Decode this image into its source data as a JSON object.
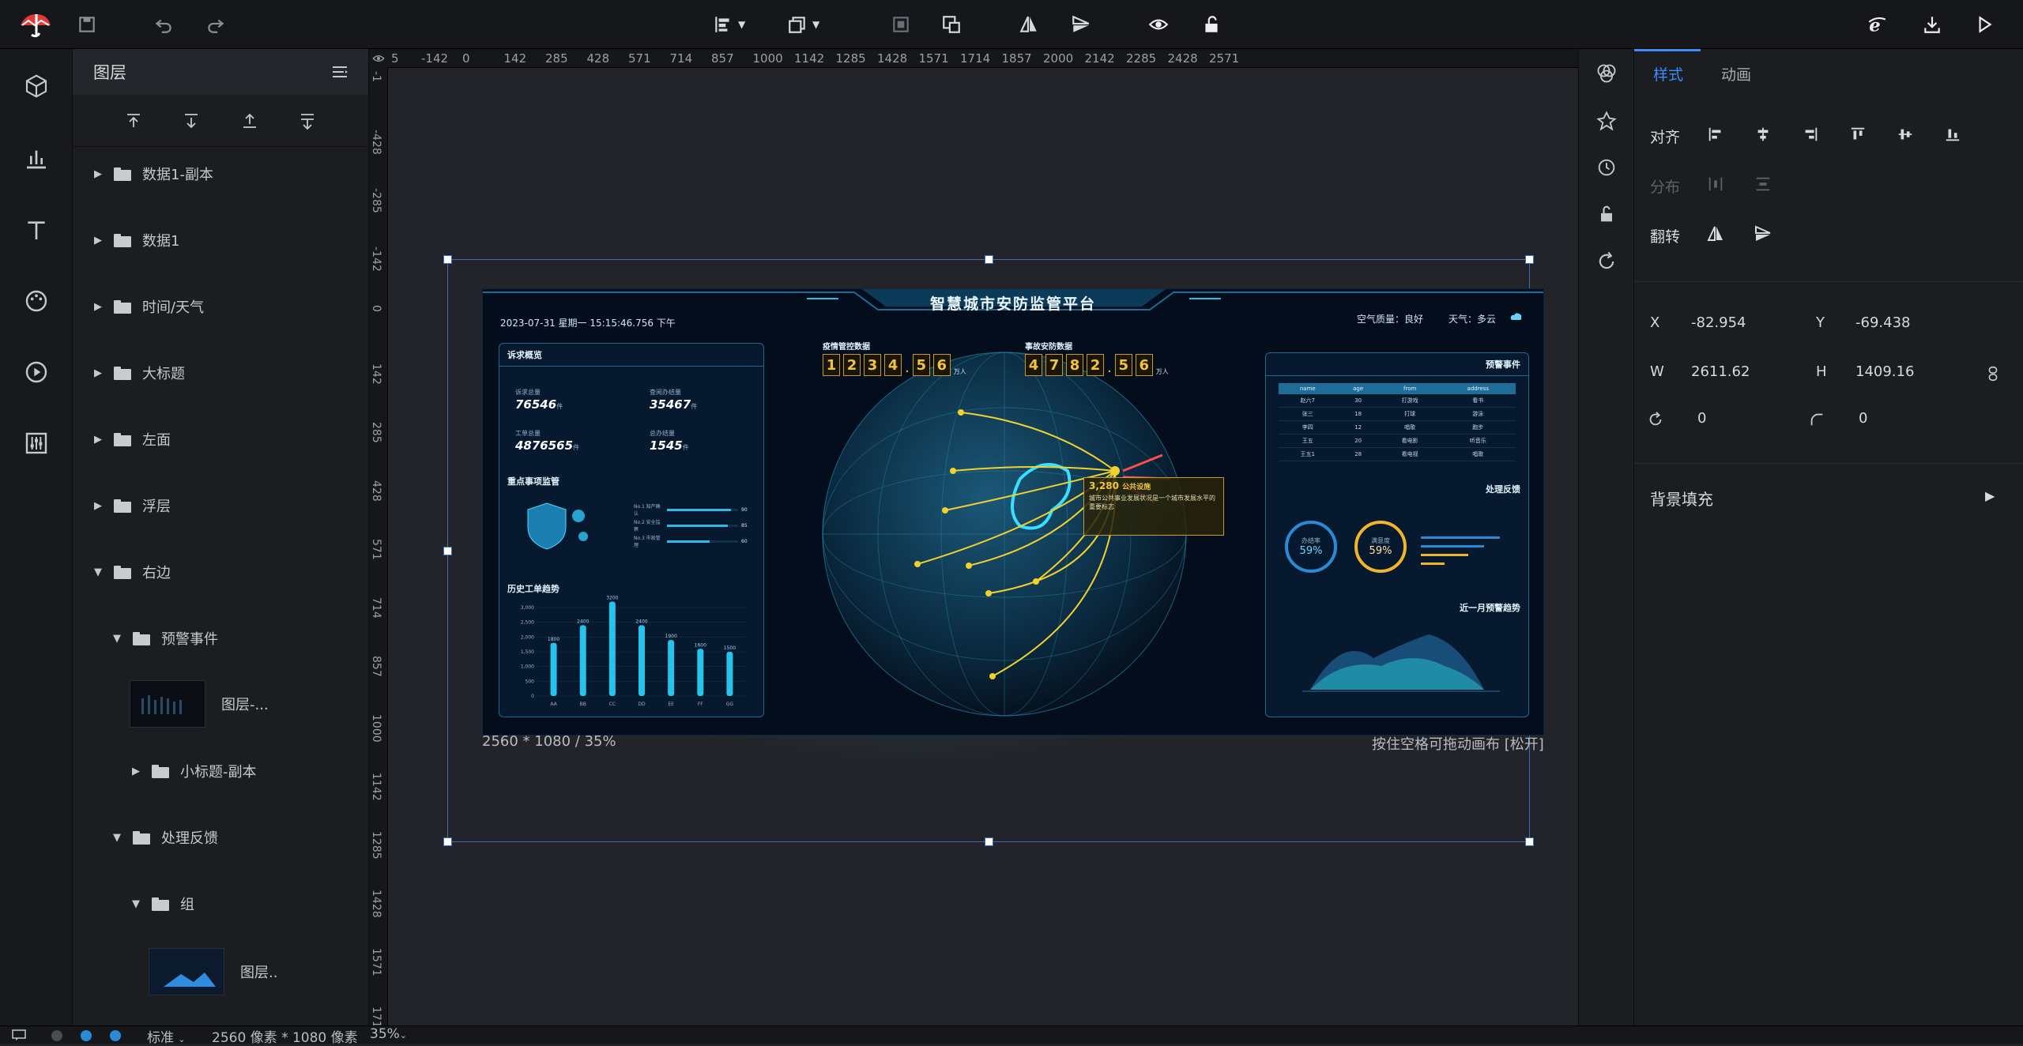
{
  "toolbar": {
    "tools": [
      "logo-icon",
      "save-icon",
      "undo-icon",
      "redo-icon",
      "align-left-icon",
      "layer-order-icon",
      "group-icon",
      "ungroup-icon",
      "flip-horizontal-icon",
      "flip-vertical-icon",
      "preview-eye-icon",
      "unlock-icon",
      "ie-icon",
      "export-icon",
      "play-icon"
    ]
  },
  "layers": {
    "title": "图层",
    "items": [
      {
        "label": "数据1-副本"
      },
      {
        "label": "数据1"
      },
      {
        "label": "时间/天气"
      },
      {
        "label": "大标题"
      },
      {
        "label": "左面"
      },
      {
        "label": "浮层"
      },
      {
        "label": "右边"
      },
      {
        "label": "预警事件"
      },
      {
        "label": "图层-..."
      },
      {
        "label": "小标题-副本"
      },
      {
        "label": "处理反馈"
      },
      {
        "label": "组"
      },
      {
        "label": "图层.."
      }
    ]
  },
  "ruler": {
    "top": [
      "5",
      "-142",
      "0",
      "142",
      "285",
      "428",
      "571",
      "714",
      "857",
      "1000",
      "1142",
      "1285",
      "1428",
      "1571",
      "1714",
      "1857",
      "2000",
      "2142",
      "2285",
      "2428",
      "2571"
    ],
    "left": [
      "-1",
      "-428",
      "-285",
      "-142",
      "0",
      "142",
      "285",
      "428",
      "571",
      "714",
      "857",
      "1000",
      "1142",
      "1285",
      "1428",
      "1571",
      "171"
    ]
  },
  "canvas": {
    "size_label": "2560 * 1080 / 35%",
    "drag_hint": "按住空格可拖动画布 [松开]"
  },
  "dashboard": {
    "title": "智慧城市安防监管平台",
    "datetime": "2023-07-31 星期一 15:15:46.756 下午",
    "air": "空气质量：良好",
    "weather": "天气：多云",
    "left_panel_title": "诉求概览",
    "stats": [
      {
        "label": "诉求总量",
        "value": "76546",
        "unit": "件"
      },
      {
        "label": "查阅办结量",
        "value": "35467",
        "unit": "件"
      },
      {
        "label": "工单总量",
        "value": "4876565",
        "unit": "件"
      },
      {
        "label": "总办结量",
        "value": "1545",
        "unit": "件"
      }
    ],
    "key_title": "重点事项监管",
    "sliders": [
      {
        "label": "No.1 知产确认",
        "value": "90",
        "level": 0.9
      },
      {
        "label": "No.2 安全监察",
        "value": "85",
        "level": 0.85
      },
      {
        "label": "No.3 市政管理",
        "value": "60",
        "level": 0.6
      }
    ],
    "history_title": "历史工单趋势",
    "counter1_title": "疫情管控数据",
    "counter1_digits": [
      "1",
      "2",
      "3",
      "4",
      ".",
      "5",
      "6"
    ],
    "counter1_unit": "万人",
    "counter2_title": "事故安防数据",
    "counter2_digits": [
      "4",
      "7",
      "8",
      "2",
      ".",
      "5",
      "6"
    ],
    "counter2_unit": "万人",
    "popup_value": "3,280",
    "popup_label": "公共设施",
    "popup_text": "城市公共事业发展状况是一个城市发展水平的重要标志",
    "right_title": "预警事件",
    "table_headers": [
      "name",
      "age",
      "from",
      "address"
    ],
    "table_rows": [
      [
        "赵六7",
        "30",
        "打游戏",
        "看书"
      ],
      [
        "张三",
        "18",
        "打球",
        "游泳"
      ],
      [
        "李四",
        "12",
        "唱歌",
        "跑步"
      ],
      [
        "王五",
        "20",
        "看电影",
        "听音乐"
      ],
      [
        "王五1",
        "28",
        "看电视",
        "唱歌"
      ]
    ],
    "feedback_title": "处理反馈",
    "gauges": [
      {
        "label": "办结率",
        "value": "59%"
      },
      {
        "label": "满意度",
        "value": "59%"
      }
    ],
    "trend_title": "近一月预警趋势"
  },
  "chart_data": {
    "type": "bar",
    "title": "历史工单趋势",
    "categories": [
      "AA",
      "BB",
      "CC",
      "DD",
      "EE",
      "FF",
      "GG"
    ],
    "values": [
      1800,
      2400,
      3200,
      2400,
      1900,
      1600,
      1500
    ],
    "ylim": [
      0,
      3000
    ],
    "ticks": [
      "3,000",
      "2,500",
      "2,000",
      "1,500",
      "1,000",
      "500",
      "0"
    ]
  },
  "props": {
    "tab_style": "样式",
    "tab_anim": "动画",
    "align_label": "对齐",
    "distribute_label": "分布",
    "flip_label": "翻转",
    "x_label": "X",
    "x_value": "-82.954",
    "y_label": "Y",
    "y_value": "-69.438",
    "w_label": "W",
    "w_value": "2611.62",
    "h_label": "H",
    "h_value": "1409.16",
    "rotate_value": "0",
    "radius_value": "0",
    "bg_label": "背景填充"
  },
  "status": {
    "mode": "标准",
    "resolution": "2560 像素 * 1080 像素",
    "zoom": "35%"
  },
  "colors": {
    "accent": "#3d8bfd",
    "selection": "#3d6fb5",
    "gold": "#f0c43c",
    "cyan": "#23c6e6"
  }
}
